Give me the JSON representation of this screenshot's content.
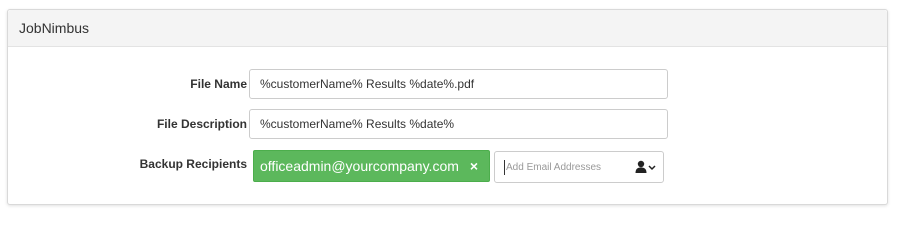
{
  "panel": {
    "title": "JobNimbus"
  },
  "form": {
    "file_name": {
      "label": "File Name",
      "value": "%customerName% Results %date%.pdf"
    },
    "file_description": {
      "label": "File Description",
      "value": "%customerName% Results %date%"
    },
    "backup_recipients": {
      "label": "Backup Recipients",
      "recipients": [
        {
          "email": "officeadmin@yourcompany.com",
          "remove_label": "×"
        }
      ],
      "input_placeholder": "Add Email Addresses",
      "contact_icon": "user-dropdown-icon"
    }
  },
  "colors": {
    "chip_bg": "#5cb85c",
    "header_bg": "#f4f4f4"
  }
}
